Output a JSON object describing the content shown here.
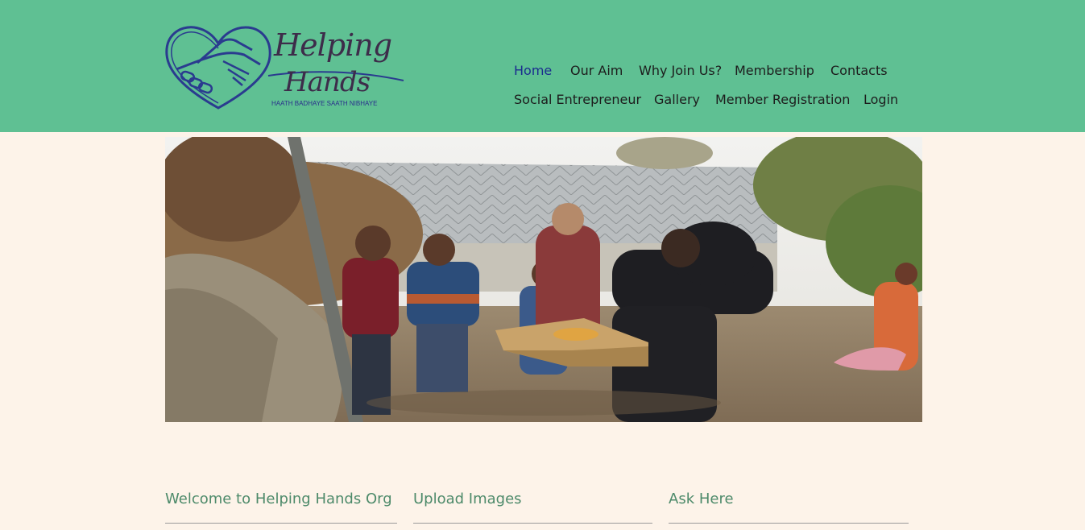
{
  "header": {
    "background_color": "#5fc093",
    "logo": {
      "title_line1": "Helping",
      "title_line2": "Hands",
      "tagline": "HAATH BADHAYE SAATH NIBHAYE",
      "icon": "handshake-heart-icon"
    },
    "nav": {
      "home": "Home",
      "our_aim": "Our Aim",
      "why_join": "Why Join Us?",
      "membership": "Membership",
      "contacts": "Contacts",
      "social_entrepreneur": "Social Entrepreneur",
      "gallery": "Gallery",
      "member_registration": "Member Registration",
      "login": "Login"
    },
    "active_nav": "Home",
    "active_color": "#1b2d8f"
  },
  "hero": {
    "image": "photo of a man handing out fruit from a cardboard box to village children in front of a slate-roofed house"
  },
  "sections": {
    "welcome": "Welcome to Helping Hands Org",
    "upload": "Upload Images",
    "ask": "Ask Here"
  },
  "colors": {
    "page_background": "#fdf3e9",
    "section_title": "#4d8a6a"
  }
}
